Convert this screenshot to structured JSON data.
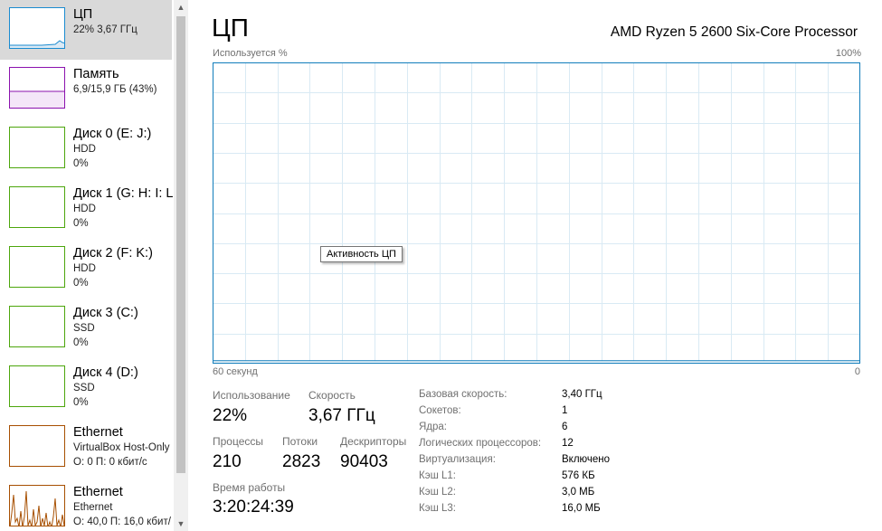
{
  "sidebar": {
    "items": [
      {
        "title": "ЦП",
        "line1": "22% 3,67 ГГц",
        "line2": "",
        "color": "#1a8bd0"
      },
      {
        "title": "Память",
        "line1": "6,9/15,9 ГБ (43%)",
        "line2": "",
        "color": "#8b12ae"
      },
      {
        "title": "Диск 0 (E: J:)",
        "line1": "HDD",
        "line2": "0%",
        "color": "#4da60c"
      },
      {
        "title": "Диск 1 (G: H: I: L",
        "line1": "HDD",
        "line2": "0%",
        "color": "#4da60c"
      },
      {
        "title": "Диск 2 (F: K:)",
        "line1": "HDD",
        "line2": "0%",
        "color": "#4da60c"
      },
      {
        "title": "Диск 3 (C:)",
        "line1": "SSD",
        "line2": "0%",
        "color": "#4da60c"
      },
      {
        "title": "Диск 4 (D:)",
        "line1": "SSD",
        "line2": "0%",
        "color": "#4da60c"
      },
      {
        "title": "Ethernet",
        "line1": "VirtualBox Host-Only",
        "line2": "О: 0 П: 0 кбит/с",
        "color": "#a74f01"
      },
      {
        "title": "Ethernet",
        "line1": "Ethernet",
        "line2": "О: 40,0 П: 16,0 кбит/",
        "color": "#a74f01"
      }
    ]
  },
  "scrollbar": {
    "up_arrow": "▲",
    "down_arrow": "▼"
  },
  "main": {
    "title": "ЦП",
    "cpu_model": "AMD Ryzen 5 2600 Six-Core Processor",
    "graph_label": "Используется %",
    "graph_max": "100%",
    "time_left": "60 секунд",
    "time_right": "0",
    "tooltip": "Активность ЦП"
  },
  "chart_data": {
    "type": "area",
    "ylim": [
      0,
      100
    ],
    "xlim": [
      60,
      0
    ],
    "x_unit": "seconds",
    "values": [
      1,
      1,
      1,
      1,
      1,
      1,
      1,
      1,
      1,
      1,
      1,
      1,
      1,
      1,
      1,
      1,
      1,
      1,
      1,
      1,
      1,
      1,
      1,
      1,
      1,
      1,
      1,
      1,
      1,
      1,
      1,
      1,
      1,
      1,
      1,
      1,
      1,
      1,
      1,
      1,
      1,
      1,
      1,
      1,
      1,
      1,
      1,
      1,
      1,
      1,
      1,
      1,
      1,
      1,
      1,
      1,
      1,
      1,
      1,
      1,
      1
    ],
    "line_color": "#117dbb",
    "fill_color": "#f1f6fa",
    "grid_color": "#d9eaf4"
  },
  "stats": {
    "usage_label": "Использование",
    "usage_value": "22%",
    "speed_label": "Скорость",
    "speed_value": "3,67 ГГц",
    "processes_label": "Процессы",
    "processes_value": "210",
    "threads_label": "Потоки",
    "threads_value": "2823",
    "handles_label": "Дескрипторы",
    "handles_value": "90403",
    "uptime_label": "Время работы",
    "uptime_value": "3:20:24:39"
  },
  "specs": [
    {
      "label": "Базовая скорость:",
      "value": "3,40 ГГц"
    },
    {
      "label": "Сокетов:",
      "value": "1"
    },
    {
      "label": "Ядра:",
      "value": "6"
    },
    {
      "label": "Логических процессоров:",
      "value": "12"
    },
    {
      "label": "Виртуализация:",
      "value": "Включено"
    },
    {
      "label": "Кэш L1:",
      "value": "576 КБ"
    },
    {
      "label": "Кэш L2:",
      "value": "3,0 МБ"
    },
    {
      "label": "Кэш L3:",
      "value": "16,0 МБ"
    }
  ]
}
